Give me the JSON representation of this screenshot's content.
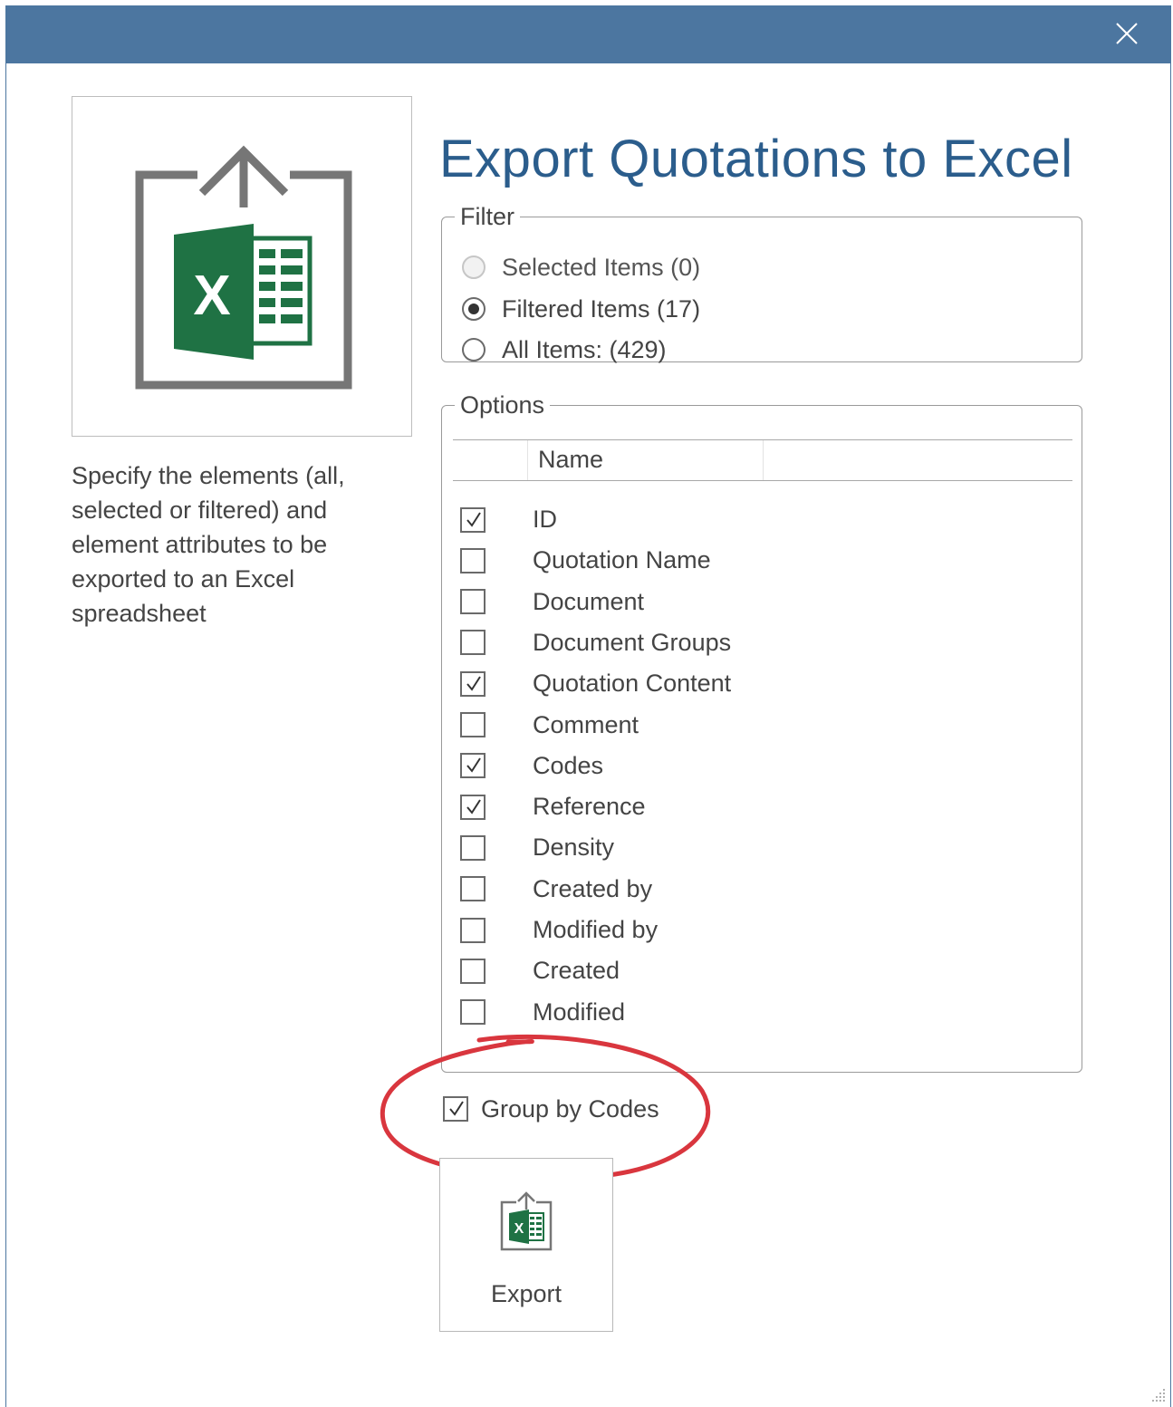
{
  "dialog": {
    "title": "Export Quotations to Excel",
    "description": "Specify the elements (all, selected or filtered) and element attributes to be exported to an Excel spreadsheet",
    "colors": {
      "titlebar": "#4c76a0",
      "title_text": "#2b5d8c",
      "excel_green": "#1f7244",
      "highlight": "#d9363e"
    },
    "icons": {
      "close": "close-icon",
      "logo": "excel-export-icon",
      "export": "excel-export-small-icon"
    }
  },
  "filter": {
    "legend": "Filter",
    "options": [
      {
        "label": "Selected Items (0)",
        "checked": false,
        "disabled": true
      },
      {
        "label": "Filtered Items (17)",
        "checked": true,
        "disabled": false
      },
      {
        "label": "All Items: (429)",
        "checked": false,
        "disabled": false
      }
    ]
  },
  "options": {
    "legend": "Options",
    "column_header": "Name",
    "items": [
      {
        "label": "ID",
        "checked": true
      },
      {
        "label": "Quotation Name",
        "checked": false
      },
      {
        "label": "Document",
        "checked": false
      },
      {
        "label": "Document Groups",
        "checked": false
      },
      {
        "label": "Quotation Content",
        "checked": true
      },
      {
        "label": "Comment",
        "checked": false
      },
      {
        "label": "Codes",
        "checked": true
      },
      {
        "label": "Reference",
        "checked": true
      },
      {
        "label": "Density",
        "checked": false
      },
      {
        "label": "Created by",
        "checked": false
      },
      {
        "label": "Modified by",
        "checked": false
      },
      {
        "label": "Created",
        "checked": false
      },
      {
        "label": "Modified",
        "checked": false
      }
    ]
  },
  "group_by_codes": {
    "label": "Group by Codes",
    "checked": true
  },
  "export_button": {
    "label": "Export"
  }
}
